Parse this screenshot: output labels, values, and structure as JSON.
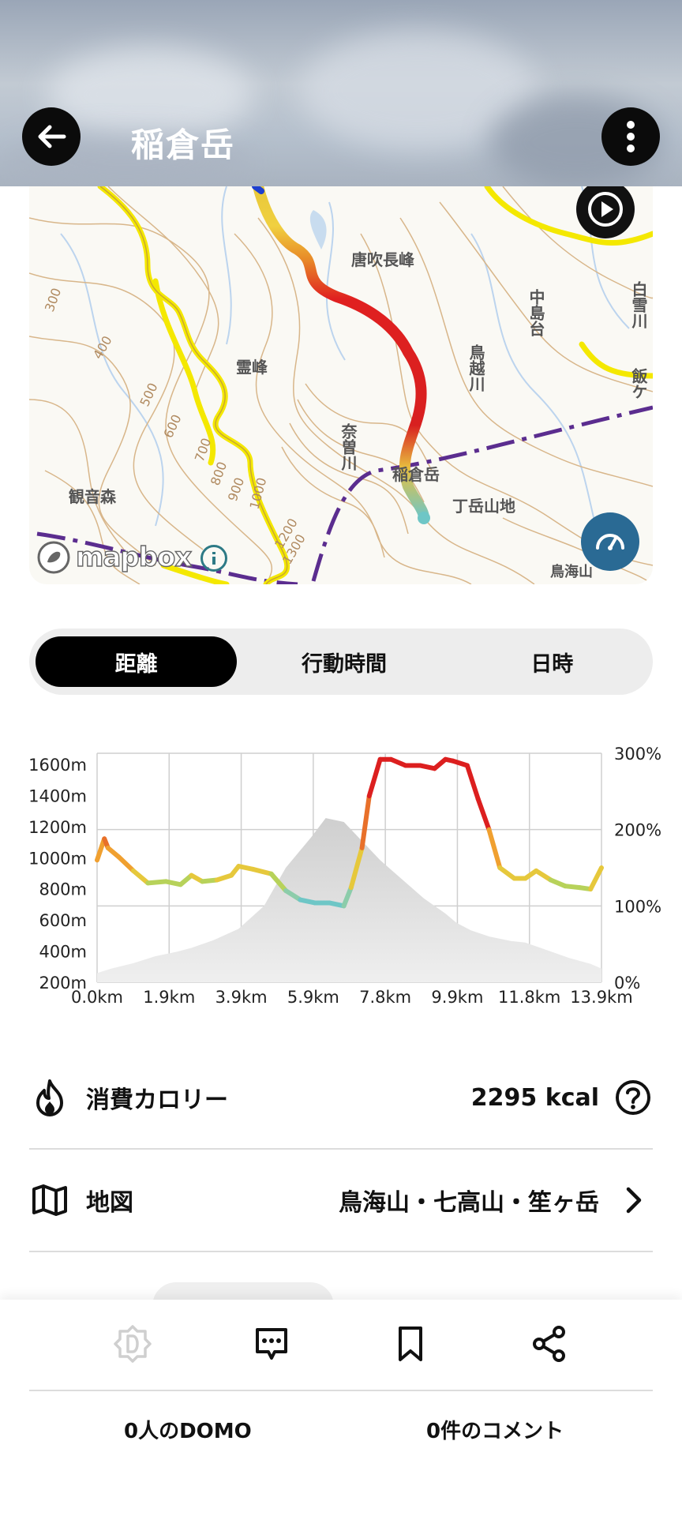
{
  "header": {
    "title": "稲倉岳"
  },
  "map": {
    "place_labels": [
      "唐吹長峰",
      "中島台",
      "霊峰",
      "鳥越川",
      "奈曽川",
      "稲倉岳",
      "丁岳山地",
      "観音森",
      "白雪川",
      "飯ケ",
      "鳥海山"
    ],
    "contour_labels": [
      "300",
      "400",
      "500",
      "600",
      "700",
      "800",
      "900",
      "1000",
      "1200",
      "1300"
    ],
    "attribution": "mapbox"
  },
  "segments": {
    "tabs": [
      "距離",
      "行動時間",
      "日時"
    ],
    "active": 0
  },
  "chart_data": {
    "type": "line",
    "x_tick_labels": [
      "0.0km",
      "1.9km",
      "3.9km",
      "5.9km",
      "7.8km",
      "9.9km",
      "11.8km",
      "13.9km"
    ],
    "y_left_tick_labels": [
      "1600m",
      "1400m",
      "1200m",
      "1000m",
      "800m",
      "600m",
      "400m",
      "200m"
    ],
    "y_right_tick_labels": [
      "300%",
      "200%",
      "100%",
      "0%"
    ],
    "xlim_km": [
      0,
      13.9
    ],
    "ylim_left_m": [
      200,
      1700
    ],
    "ylim_right_pct": [
      0,
      300
    ],
    "grid": true,
    "series": [
      {
        "x": [
          0.0,
          0.2,
          0.3,
          0.6,
          1.0,
          1.4,
          1.9,
          2.3,
          2.6,
          2.9,
          3.3,
          3.7,
          3.9,
          4.3,
          4.8,
          5.2,
          5.6,
          6.0,
          6.4,
          6.8,
          7.0,
          7.3,
          7.5,
          7.8,
          8.1,
          8.5,
          8.9,
          9.3,
          9.6,
          9.8,
          10.2,
          10.5,
          10.8,
          11.1,
          11.5,
          11.8,
          12.1,
          12.5,
          12.9,
          13.3,
          13.6,
          13.9
        ],
        "y": [
          1000,
          1140,
          1080,
          1020,
          930,
          850,
          860,
          840,
          900,
          860,
          870,
          900,
          960,
          940,
          910,
          800,
          740,
          720,
          720,
          700,
          820,
          1080,
          1420,
          1660,
          1660,
          1620,
          1620,
          1600,
          1660,
          1650,
          1620,
          1400,
          1200,
          950,
          880,
          880,
          930,
          870,
          830,
          820,
          810,
          950
        ]
      },
      {
        "x": [
          0.0,
          0.4,
          1.0,
          1.6,
          2.2,
          2.6,
          3.2,
          3.9,
          4.6,
          5.2,
          5.9,
          6.3,
          6.8,
          7.3,
          7.8,
          8.4,
          9.0,
          9.6,
          9.9,
          10.3,
          10.8,
          11.4,
          11.8,
          12.4,
          13.0,
          13.6,
          13.9
        ],
        "y_pct": [
          12,
          18,
          25,
          34,
          40,
          45,
          55,
          70,
          100,
          150,
          190,
          215,
          210,
          185,
          160,
          135,
          110,
          90,
          78,
          68,
          60,
          54,
          52,
          42,
          32,
          24,
          18
        ]
      }
    ]
  },
  "info": {
    "calorie_label": "消費カロリー",
    "calorie_value": "2295 kcal",
    "map_label": "地図",
    "map_value": "鳥海山・七高山・笙ヶ岳"
  },
  "bottom": {
    "domo_count": "0人のDOMO",
    "comment_count": "0件のコメント"
  },
  "colors": {
    "route_low": "#6ec6c6",
    "route_mid": "#e8d84a",
    "route_high": "#e02020",
    "accent": "#2a6a94"
  }
}
